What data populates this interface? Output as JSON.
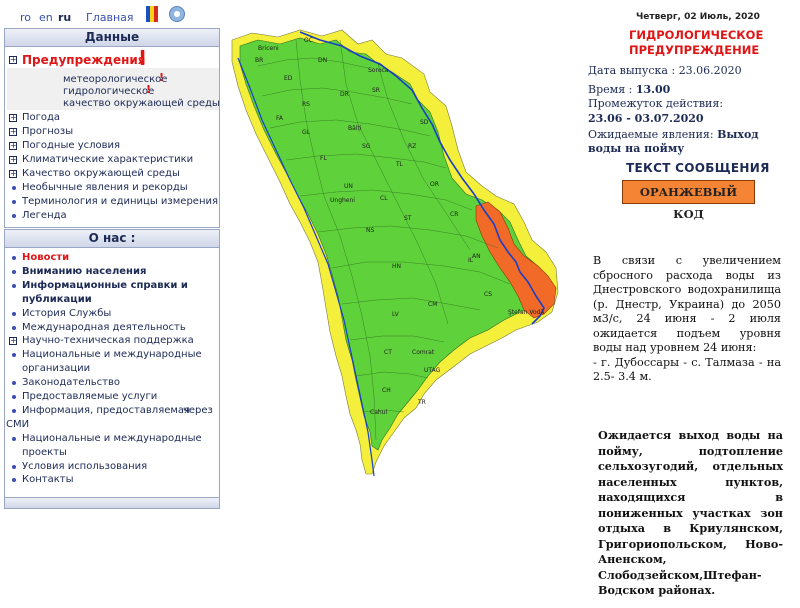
{
  "top": {
    "lang_ro": "ro",
    "lang_en": "en",
    "lang_ru": "ru",
    "home": "Главная"
  },
  "panel1": {
    "title": "Данные",
    "warnings": "Предупреждения",
    "sub_items": [
      "метеорологическое",
      "гидрологическое",
      "качество окружающей среды"
    ],
    "items": [
      {
        "label": "Погода",
        "type": "plus"
      },
      {
        "label": "Прогнозы",
        "type": "plus"
      },
      {
        "label": "Погодные условия",
        "type": "plus"
      },
      {
        "label": "Климатические характеристики",
        "type": "plus"
      },
      {
        "label": "Качество окружающей среды",
        "type": "plus"
      },
      {
        "label": "Необычные явления и рекорды",
        "type": "dot"
      },
      {
        "label": "Терминология и единицы измерения",
        "type": "dot"
      },
      {
        "label": "Легенда",
        "type": "dot"
      }
    ]
  },
  "panel2": {
    "title": "О нас :",
    "items": [
      {
        "label": "Новости",
        "type": "dot"
      },
      {
        "label": "Вниманию населения",
        "type": "dot"
      },
      {
        "label": "Информационные справки и",
        "type": "dot"
      },
      {
        "label": "публикации",
        "type": "none"
      },
      {
        "label": "История Службы",
        "type": "dot"
      },
      {
        "label": "Международная деятельность",
        "type": "dot"
      },
      {
        "label": "Научно-техническая поддержка",
        "type": "plus"
      },
      {
        "label": "Национальные и международные",
        "type": "dot"
      },
      {
        "label": "организации",
        "type": "none"
      },
      {
        "label": "Законодательство",
        "type": "dot"
      },
      {
        "label": "Предоставляемые услуги",
        "type": "dot"
      },
      {
        "label": "Информация, предоставляемая",
        "type": "dot",
        "extra": "через"
      },
      {
        "label": "СМИ",
        "type": "flush"
      },
      {
        "label": "Национальные и международные",
        "type": "dot"
      },
      {
        "label": "проекты",
        "type": "none"
      },
      {
        "label": "Условия использования",
        "type": "dot"
      },
      {
        "label": "Контакты",
        "type": "dot"
      }
    ]
  },
  "map": {
    "districts": [
      "OC",
      "Briceni",
      "BR",
      "DN",
      "ED",
      "DR",
      "RS",
      "SR",
      "Soroca",
      "FL",
      "SG",
      "FA",
      "Bălți",
      "GL",
      "RZ",
      "TL",
      "SD",
      "OR",
      "UN",
      "Ungheni",
      "CL",
      "NS",
      "ST",
      "HN",
      "CR",
      "IL",
      "AN",
      "CS",
      "CM",
      "LV",
      "Ştefan Vodă",
      "CT",
      "Comrat",
      "UTAG",
      "CH",
      "TR",
      "Cahul"
    ]
  },
  "right": {
    "date": "Четверг, 02 Июль, 2020",
    "warning_title_1": "ГИДРОЛОГИЧЕСКОЕ",
    "warning_title_2": "ПРЕДУПРЕЖДЕНИЕ",
    "issue_label": "Дата выпуска : ",
    "issue_value": "23.06.2020",
    "time_label": "Время : ",
    "time_value": "13.00",
    "period_label": "Промежуток действия:",
    "period_value": "23.06 - 03.07.2020",
    "expected_label": "Ожидаемые явления: ",
    "expected_value": "Выход воды на пойму",
    "message_title": "ТЕКСТ СООБЩЕНИЯ",
    "code_button": "ОРАНЖЕВЫЙ КОД",
    "message_body": "В связи с увеличением сбросного расхода воды из Днестровского водохранилища (р. Днестр, Украина) до 2050 м3/с, 24 июня - 2 июля ожидается подъем уровня воды над уровнем 24 июня:",
    "message_line": "- г. Дубоссары - с. Талмаза - на 2.5- 3.4 м.",
    "bold_body": "Ожидается выход воды на пойму, подтопление сельхозугодий, отдельных населенных пунктов, находящихся в пониженных участках зон отдыха в Криулянском, Григориопольском, Ново-Аненском, Слободзейском,Штефан-Водском районах."
  },
  "colors": {
    "green": "#5fd13a",
    "yellow": "#f4ef3a",
    "orange": "#f26a28",
    "accent_red": "#e01515",
    "link_blue": "#3b4fb0"
  }
}
